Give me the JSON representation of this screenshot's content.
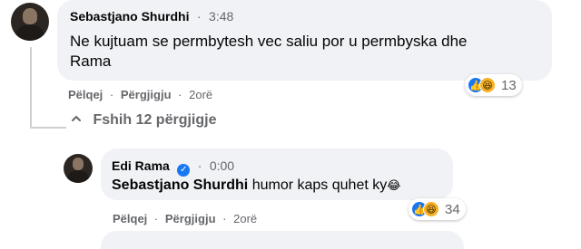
{
  "comment1": {
    "author": "Sebastjano Shurdhi",
    "time": "3:48",
    "text": "Ne kujtuam se permbytesh vec saliu por u permbyska dhe Rama",
    "reaction_count": "13",
    "like_label": "Pëlqej",
    "reply_label": "Përgjigju",
    "age": "2orë"
  },
  "hide_replies": {
    "label": "Fshih 12 përgjigje"
  },
  "reply1": {
    "author": "Edi Rama",
    "time": "0:00",
    "mention": "Sebastjano Shurdhi",
    "text": "humor kaps quhet ky",
    "emoji": "😂",
    "reaction_count": "34",
    "like_label": "Pëlqej",
    "reply_label": "Përgjigju",
    "age": "2orë"
  },
  "separator": "·"
}
